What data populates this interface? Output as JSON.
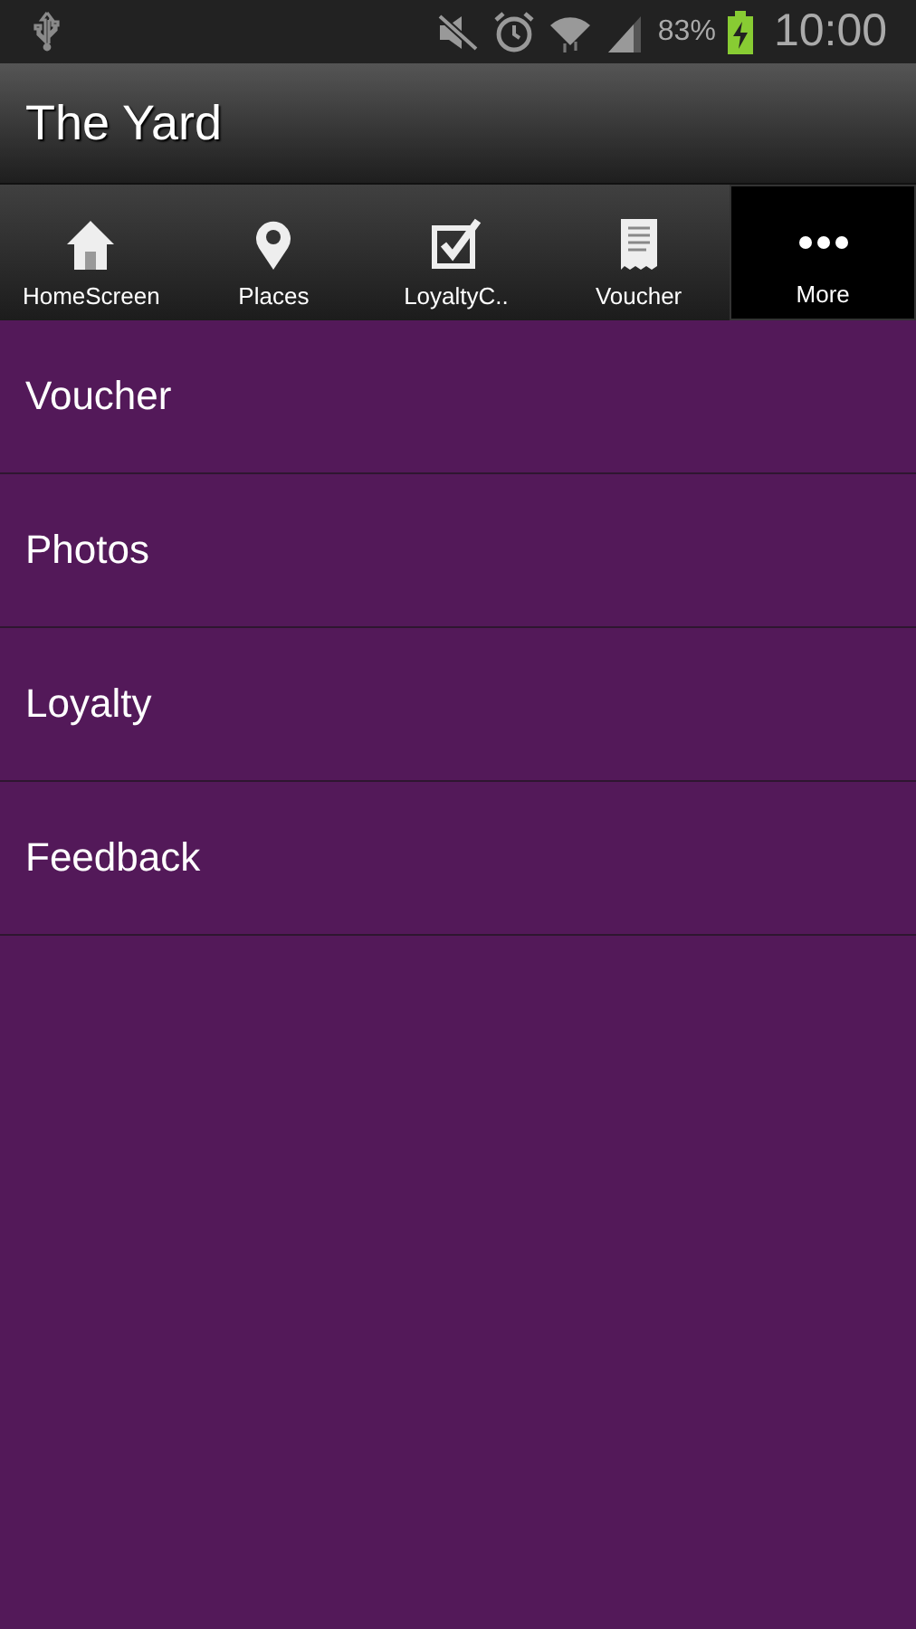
{
  "status_bar": {
    "battery_percent": "83%",
    "time": "10:00"
  },
  "header": {
    "title": "The Yard"
  },
  "tabs": [
    {
      "label": "HomeScreen",
      "selected": false
    },
    {
      "label": "Places",
      "selected": false
    },
    {
      "label": "LoyaltyC..",
      "selected": false
    },
    {
      "label": "Voucher",
      "selected": false
    },
    {
      "label": "More",
      "selected": true
    }
  ],
  "menu": [
    {
      "label": "Voucher"
    },
    {
      "label": "Photos"
    },
    {
      "label": "Loyalty"
    },
    {
      "label": "Feedback"
    }
  ]
}
